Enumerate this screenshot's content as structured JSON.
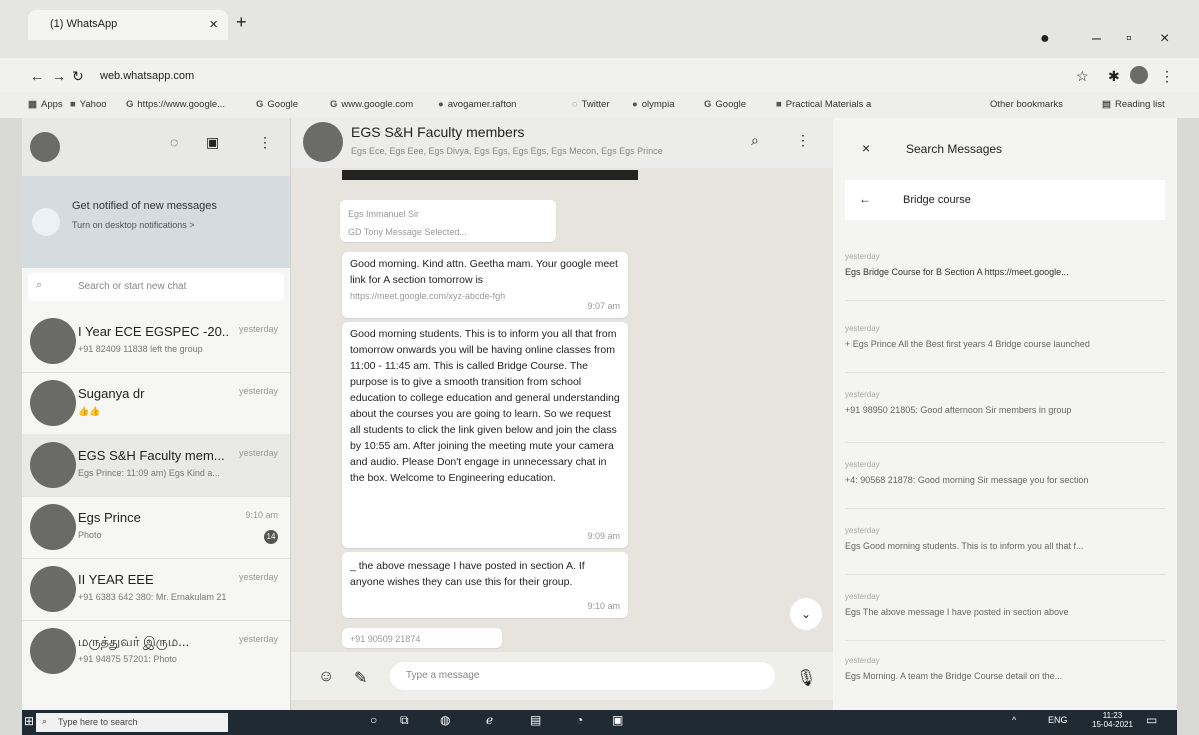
{
  "browser": {
    "tab_title": "(1) WhatsApp",
    "tab_close": "×",
    "new_tab": "+",
    "url": "web.whatsapp.com",
    "bookmarks": [
      "Apps",
      "Yahoo",
      "https://www.google...",
      "Google",
      "www.google.com",
      "avogamer.rafton",
      "Twitter",
      "olympia",
      "Google",
      "Practical Materials a",
      "Other bookmarks",
      "Reading list"
    ]
  },
  "sidebar": {
    "notification_title": "Get notified of new messages",
    "notification_link": "Turn on desktop notifications >",
    "search_placeholder": "Search or start new chat",
    "chats": [
      {
        "name": "I Year ECE EGSPEC -20...",
        "preview": "+91 82409 11838 left the group",
        "time": "yesterday"
      },
      {
        "name": "Suganya dr",
        "preview": "👍👍",
        "time": "yesterday"
      },
      {
        "name": "EGS S&H Faculty mem...",
        "preview": "Egs Prince: 11:09 am) Egs Kind a...",
        "time": "yesterday"
      },
      {
        "name": "Egs Prince",
        "preview": "Photo",
        "time": "9:10 am",
        "badge": "14"
      },
      {
        "name": "II YEAR EEE",
        "preview": "+91 6383 642 380: Mr. Ernakulam 21",
        "time": "yesterday"
      },
      {
        "name": "மருத்துவர் இரும...",
        "preview": "+91 94875 57201: Photo",
        "time": "yesterday"
      }
    ]
  },
  "conversation": {
    "title": "EGS S&H Faculty members",
    "subtitle": "Egs Ece, Egs Eee, Egs Divya, Egs Egs, Egs Egs, Egs Mecon, Egs Egs Prince",
    "quoted_name": "Egs Immanuel Sir",
    "quoted_text": "GD Tony Message Selected...",
    "msg1": "Good morning. Kind attn. Geetha mam. Your google meet link for A section tomorrow is",
    "msg1_link": "https://meet.google.com/xyz-abcde-fgh",
    "msg1_time": "9:07 am",
    "msg2": "Good morning students. This is to inform you all that from tomorrow onwards you will be having online classes from 11:00 - 11:45 am. This is called Bridge Course. The purpose is to give a smooth transition from school education to college education and general understanding about the courses you are going to learn. So we request all students to click the link given below and join the class by 10:55 am. After joining the meeting mute your camera and audio. Please Don't engage in unnecessary chat in the box. Welcome to Engineering education.",
    "msg2_time": "9:09 am",
    "msg3": "_ the above message I have posted in section A. If anyone wishes they can use this for their group.",
    "msg3_time": "9:10 am",
    "msg4_sender": "+91 90509 21874",
    "input_placeholder": "Type a message"
  },
  "search_panel": {
    "title": "Search Messages",
    "query": "Bridge course",
    "results": [
      {
        "date": "yesterday",
        "text": "Egs Bridge Course for B Section A https://meet.google..."
      },
      {
        "date": "yesterday",
        "text": "+ Egs Prince All the Best first years 4 Bridge course launched"
      },
      {
        "date": "yesterday",
        "text": "+91 98950 21805: Good afternoon Sir members in group"
      },
      {
        "date": "yesterday",
        "text": "+4: 90568 21878: Good morning Sir message you for section"
      },
      {
        "date": "yesterday",
        "text": "Egs Good morning students. This is to inform you all that f..."
      },
      {
        "date": "yesterday",
        "text": "Egs The above message I have posted in section above"
      },
      {
        "date": "yesterday",
        "text": "Egs Morning. A team the Bridge Course detail on the..."
      }
    ]
  },
  "taskbar": {
    "search_placeholder": "Type here to search",
    "lang": "ENG",
    "time": "11:23",
    "date": "15-04-2021"
  }
}
